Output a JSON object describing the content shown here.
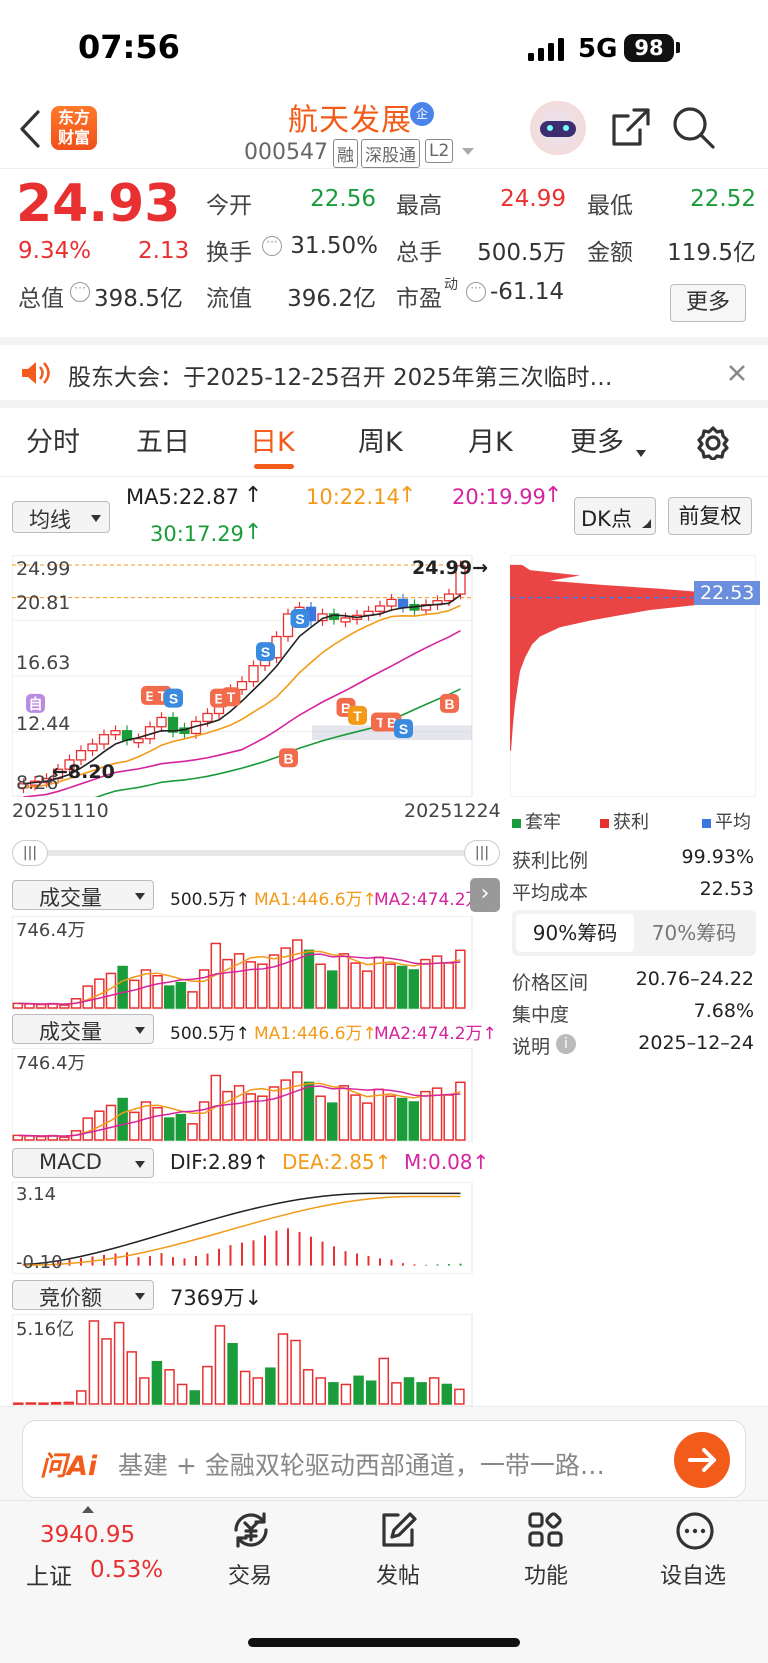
{
  "status_bar": {
    "time": "07:56",
    "network": "5G",
    "battery": "98"
  },
  "header": {
    "logo_line1": "东方",
    "logo_line2": "财富",
    "stock_name": "航天发展",
    "badge": "企",
    "code": "000547",
    "tags": [
      "融",
      "深股通",
      "L2"
    ]
  },
  "quote": {
    "price": "24.93",
    "change_pct": "9.34%",
    "change": "2.13",
    "rows": [
      [
        {
          "label": "今开",
          "value": "22.56",
          "color": "green"
        },
        {
          "label": "最高",
          "value": "24.99",
          "color": "red"
        },
        {
          "label": "最低",
          "value": "22.52",
          "color": "green"
        }
      ],
      [
        {
          "label": "换手",
          "value": "31.50%",
          "color": "dark"
        },
        {
          "label": "总手",
          "value": "500.5万",
          "color": "dark"
        },
        {
          "label": "金额",
          "value": "119.5亿",
          "color": "dark"
        }
      ],
      [
        {
          "label": "总值",
          "value": "398.5亿",
          "color": "dark"
        },
        {
          "label": "流值",
          "value": "396.2亿",
          "color": "dark"
        },
        {
          "label": "市盈",
          "sup": "动",
          "value": "-61.14",
          "color": "dark"
        }
      ]
    ],
    "more_button": "更多"
  },
  "notice": {
    "text": "股东大会：于2025-12-25召开 2025年第三次临时…"
  },
  "tabs": {
    "items": [
      "分时",
      "五日",
      "日K",
      "周K",
      "月K",
      "更多"
    ],
    "active": "日K"
  },
  "chart_controls": {
    "ma_select": "均线",
    "ma5": "MA5:22.87",
    "ma10": "10:22.14",
    "ma20": "20:19.99",
    "ma30": "30:17.29",
    "dk_button": "DK点",
    "adjust_button": "前复权"
  },
  "kline": {
    "y_labels": [
      "24.99",
      "20.81",
      "16.63",
      "12.44",
      "8.26"
    ],
    "date_start": "20251110",
    "date_end": "20251224",
    "high_marker": "24.99",
    "low_marker": "8.20"
  },
  "chips": {
    "price_tag": "22.53",
    "legend": [
      {
        "label": "套牢",
        "color": "#1a9c3a"
      },
      {
        "label": "获利",
        "color": "#e93030"
      },
      {
        "label": "平均",
        "color": "#3a78e0"
      }
    ],
    "rows1": [
      {
        "label": "获利比例",
        "value": "99.93%"
      },
      {
        "label": "平均成本",
        "value": "22.53"
      }
    ],
    "toggle": [
      "90%筹码",
      "70%筹码"
    ],
    "rows2": [
      {
        "label": "价格区间",
        "value": "20.76–24.22"
      },
      {
        "label": "集中度",
        "value": "7.68%"
      },
      {
        "label": "说明",
        "value": "2025–12–24"
      }
    ]
  },
  "volume_panel": {
    "select": "成交量",
    "vol": "500.5万",
    "ma1": "MA1:446.6万",
    "ma2": "MA2:474.2万",
    "ymax": "746.4万"
  },
  "volume_panel2": {
    "select": "成交量",
    "vol": "500.5万",
    "ma1": "MA1:446.6万",
    "ma2": "MA2:474.2万",
    "ymax": "746.4万"
  },
  "macd_panel": {
    "select": "MACD",
    "dif": "DIF:2.89",
    "dea": "DEA:2.85",
    "m": "M:0.08",
    "ymax": "3.14",
    "ymin": "-0.10"
  },
  "auction_panel": {
    "select": "竞价额",
    "value": "7369万",
    "ymax": "5.16亿"
  },
  "ai_bar": {
    "brand": "问Ai",
    "text": "基建 + 金融双轮驱动西部通道，一带一路…"
  },
  "bottom_nav": {
    "index_value": "3940.95",
    "index_name": "上证",
    "index_pct": "0.53%",
    "items": [
      "交易",
      "发帖",
      "功能",
      "设自选"
    ]
  },
  "colors": {
    "red": "#e93030",
    "green": "#1a9c3a",
    "orange": "#f39a18",
    "pink": "#d6239e",
    "accent": "#ff5a1f"
  },
  "chart_data": [
    {
      "type": "candlestick",
      "title": "日K",
      "x_range": [
        "20251110",
        "20251224"
      ],
      "ylim": [
        8.26,
        24.99
      ],
      "moving_averages": {
        "MA5": 22.87,
        "MA10": 22.14,
        "MA20": 19.99,
        "MA30": 17.29
      },
      "close": [
        8.5,
        8.7,
        8.9,
        9.6,
        10.3,
        11.0,
        11.5,
        12.2,
        12.5,
        11.8,
        11.9,
        12.8,
        13.5,
        12.4,
        12.3,
        13.2,
        13.8,
        14.9,
        15.6,
        16.2,
        17.4,
        18.0,
        19.6,
        21.3,
        21.8,
        20.8,
        21.3,
        20.9,
        21.0,
        21.2,
        21.5,
        21.9,
        22.4,
        21.8,
        21.6,
        22.0,
        22.3,
        22.8,
        24.93
      ],
      "direction": [
        "u",
        "u",
        "u",
        "u",
        "u",
        "u",
        "u",
        "u",
        "u",
        "d",
        "u",
        "u",
        "u",
        "d",
        "d",
        "u",
        "u",
        "u",
        "u",
        "u",
        "u",
        "u",
        "u",
        "u",
        "u",
        "d",
        "u",
        "d",
        "u",
        "u",
        "u",
        "u",
        "u",
        "d",
        "d",
        "u",
        "u",
        "u",
        "u"
      ]
    },
    {
      "type": "bar",
      "title": "成交量",
      "ylim": [
        0,
        746.4
      ],
      "unit": "万",
      "values": [
        40,
        35,
        30,
        38,
        25,
        80,
        190,
        250,
        300,
        360,
        240,
        330,
        280,
        190,
        220,
        140,
        330,
        560,
        420,
        470,
        400,
        380,
        460,
        520,
        590,
        500,
        380,
        320,
        470,
        390,
        320,
        440,
        380,
        360,
        330,
        420,
        450,
        390,
        500.5
      ]
    },
    {
      "type": "bar",
      "title": "MACD",
      "ylim": [
        -0.1,
        3.14
      ],
      "values": [
        0.05,
        0.08,
        0.12,
        0.18,
        0.25,
        0.32,
        0.38,
        0.45,
        0.5,
        0.55,
        0.35,
        0.4,
        0.52,
        0.35,
        0.3,
        0.4,
        0.5,
        0.7,
        0.85,
        0.95,
        1.05,
        1.25,
        1.45,
        1.55,
        1.4,
        1.2,
        1.0,
        0.8,
        0.6,
        0.5,
        0.4,
        0.3,
        0.25,
        0.1,
        0.05,
        0.03,
        0.05,
        0.06,
        0.08
      ]
    },
    {
      "type": "bar",
      "title": "竞价额",
      "ylim": [
        0,
        5.16
      ],
      "unit": "亿",
      "values": [
        0.05,
        0.06,
        0.05,
        0.08,
        0.1,
        0.8,
        5.1,
        4.0,
        5.0,
        3.2,
        1.6,
        2.6,
        2.1,
        1.2,
        0.8,
        2.3,
        4.8,
        3.7,
        2.0,
        1.6,
        2.2,
        4.3,
        3.9,
        2.1,
        1.6,
        1.3,
        1.2,
        1.7,
        1.4,
        2.8,
        1.3,
        1.6,
        1.3,
        1.6,
        1.2,
        0.9
      ]
    }
  ]
}
